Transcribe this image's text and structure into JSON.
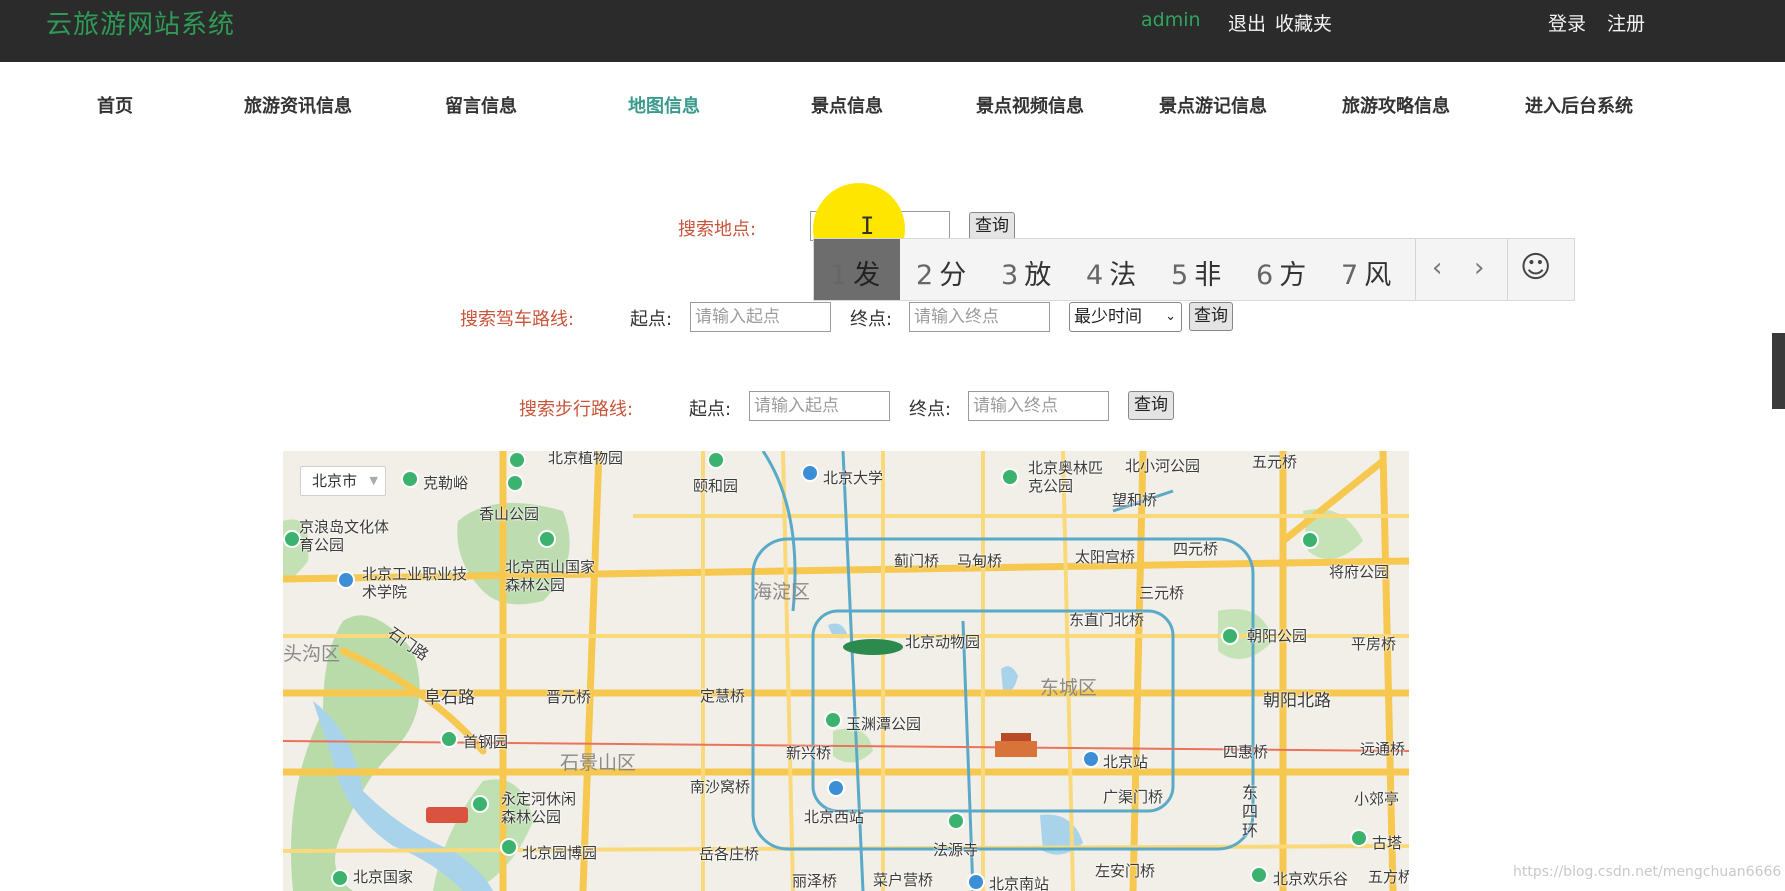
{
  "header": {
    "site_title": "云旅游网站系统",
    "user": "admin",
    "logout": "退出",
    "favorites": "收藏夹",
    "login": "登录",
    "register": "注册"
  },
  "nav": {
    "items": [
      {
        "label": "首页"
      },
      {
        "label": "旅游资讯信息"
      },
      {
        "label": "留言信息"
      },
      {
        "label": "地图信息",
        "active": true
      },
      {
        "label": "景点信息"
      },
      {
        "label": "景点视频信息"
      },
      {
        "label": "景点游记信息"
      },
      {
        "label": "旅游攻略信息"
      },
      {
        "label": "进入后台系统"
      }
    ]
  },
  "search_place": {
    "label": "搜索地点:",
    "value": "",
    "button": "查询"
  },
  "ime": {
    "candidates": [
      {
        "num": "1",
        "char": "发"
      },
      {
        "num": "2",
        "char": "分"
      },
      {
        "num": "3",
        "char": "放"
      },
      {
        "num": "4",
        "char": "法"
      },
      {
        "num": "5",
        "char": "非"
      },
      {
        "num": "6",
        "char": "方"
      },
      {
        "num": "7",
        "char": "风"
      }
    ],
    "prev": "‹",
    "next": "›",
    "emoji": "☺"
  },
  "drive_route": {
    "label": "搜索驾车路线:",
    "start_label": "起点:",
    "start_placeholder": "请输入起点",
    "end_label": "终点:",
    "end_placeholder": "请输入终点",
    "policy_selected": "最少时间",
    "button": "查询"
  },
  "walk_route": {
    "label": "搜索步行路线:",
    "start_label": "起点:",
    "start_placeholder": "请输入起点",
    "end_label": "终点:",
    "end_placeholder": "请输入终点",
    "button": "查询"
  },
  "map": {
    "city": "北京市",
    "colors": {
      "road_major": "#f7c84f",
      "ring": "#5aa9c9",
      "park": "#b6d9a8",
      "water": "#a9d3ea"
    },
    "districts": [
      "海淀区",
      "东城区",
      "石景山区",
      "头沟区"
    ],
    "labels": [
      "克勒峪",
      "北京植物园",
      "颐和园",
      "北京大学",
      "北京奥林匹克公园",
      "北小河公园",
      "五元桥",
      "香山公园",
      "望和桥",
      "京浪岛文化体育公园",
      "北京工业职业技术学院",
      "北京西山国家森林公园",
      "蓟门桥",
      "马甸桥",
      "太阳宫桥",
      "四元桥",
      "将府公园",
      "三元桥",
      "石门路",
      "北京动物园",
      "东直门北桥",
      "朝阳公园",
      "平房桥",
      "阜石路",
      "晋元桥",
      "定慧桥",
      "朝阳北路",
      "首钢园",
      "玉渊潭公园",
      "新兴桥",
      "北京站",
      "四惠桥",
      "远通桥",
      "南沙窝桥",
      "永定河休闲森林公园",
      "北京西站",
      "广渠门桥",
      "东四环",
      "小郊亭",
      "北京园博园",
      "岳各庄桥",
      "法源寺",
      "古塔",
      "北京国家",
      "丽泽桥",
      "菜户营桥",
      "北京南站",
      "左安门桥",
      "北京欢乐谷",
      "五方桥"
    ]
  },
  "watermark": "https://blog.csdn.net/mengchuan6666"
}
